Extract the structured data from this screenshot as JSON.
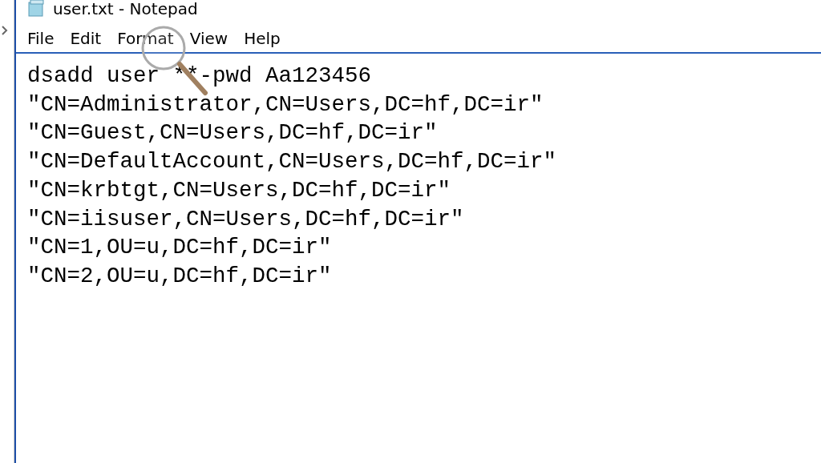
{
  "window": {
    "title": "user.txt - Notepad"
  },
  "menu": [
    "File",
    "Edit",
    "Format",
    "View",
    "Help"
  ],
  "editor": {
    "lines": [
      "dsadd user **-pwd Aa123456",
      "\"CN=Administrator,CN=Users,DC=hf,DC=ir\"",
      "\"CN=Guest,CN=Users,DC=hf,DC=ir\"",
      "\"CN=DefaultAccount,CN=Users,DC=hf,DC=ir\"",
      "\"CN=krbtgt,CN=Users,DC=hf,DC=ir\"",
      "\"CN=iisuser,CN=Users,DC=hf,DC=ir\"",
      "\"CN=1,OU=u,DC=hf,DC=ir\"",
      "\"CN=2,OU=u,DC=hf,DC=ir\""
    ]
  }
}
